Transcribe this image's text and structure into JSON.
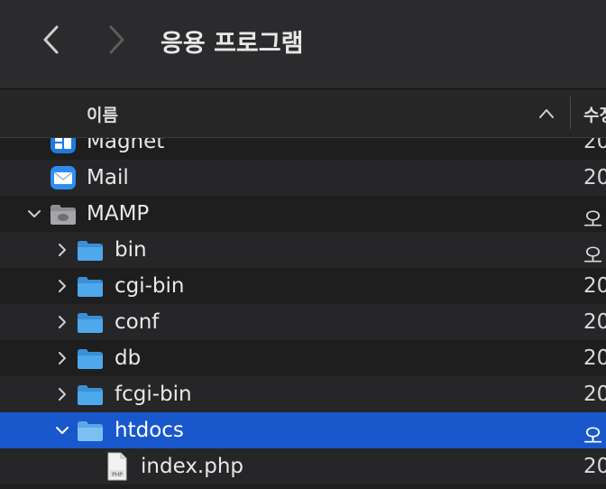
{
  "toolbar": {
    "title": "응용 프로그램",
    "back_icon": "chevron-left-icon",
    "forward_icon": "chevron-right-icon"
  },
  "columns": {
    "name_header": "이름",
    "date_header": "수정일",
    "sort_icon": "chevron-up-icon"
  },
  "colors": {
    "selection": "#1957cd",
    "folder": "#4ea8ec"
  },
  "rows": [
    {
      "label": "Magnet",
      "date": "20",
      "icon": "magnet-app-icon",
      "expanded": null,
      "selected": false
    },
    {
      "label": "Mail",
      "date": "20",
      "icon": "mail-app-icon",
      "expanded": null,
      "selected": false
    },
    {
      "label": "MAMP",
      "date": "오",
      "icon": "mamp-folder-icon",
      "expanded": true,
      "selected": false
    },
    {
      "label": "bin",
      "date": "오",
      "icon": "folder-icon",
      "expanded": false,
      "selected": false
    },
    {
      "label": "cgi-bin",
      "date": "20",
      "icon": "folder-icon",
      "expanded": false,
      "selected": false
    },
    {
      "label": "conf",
      "date": "20",
      "icon": "folder-icon",
      "expanded": false,
      "selected": false
    },
    {
      "label": "db",
      "date": "20",
      "icon": "folder-icon",
      "expanded": false,
      "selected": false
    },
    {
      "label": "fcgi-bin",
      "date": "20",
      "icon": "folder-icon",
      "expanded": false,
      "selected": false
    },
    {
      "label": "htdocs",
      "date": "오",
      "icon": "folder-icon",
      "expanded": true,
      "selected": true
    },
    {
      "label": "index.php",
      "date": "20",
      "icon": "php-file-icon",
      "expanded": null,
      "selected": false
    }
  ]
}
